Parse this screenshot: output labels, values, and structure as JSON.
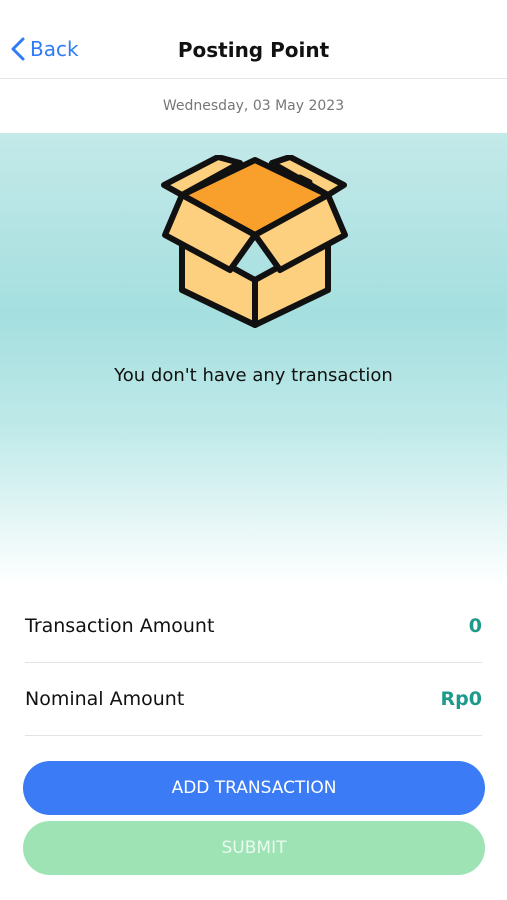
{
  "header": {
    "back_label": "Back",
    "title": "Posting Point"
  },
  "date": "Wednesday, 03 May 2023",
  "empty_state": {
    "icon": "empty-box-icon",
    "message": "You don't have any transaction"
  },
  "summary": {
    "rows": [
      {
        "label": "Transaction Amount",
        "value": "0"
      },
      {
        "label": "Nominal Amount",
        "value": "Rp0"
      }
    ]
  },
  "actions": {
    "add_label": "ADD TRANSACTION",
    "submit_label": "SUBMIT"
  },
  "colors": {
    "accent": "#3b7cf6",
    "value": "#1e9a8c",
    "submit_disabled": "#9ee3b4",
    "box_orange": "#f9a02c",
    "box_light": "#fcd07e"
  }
}
